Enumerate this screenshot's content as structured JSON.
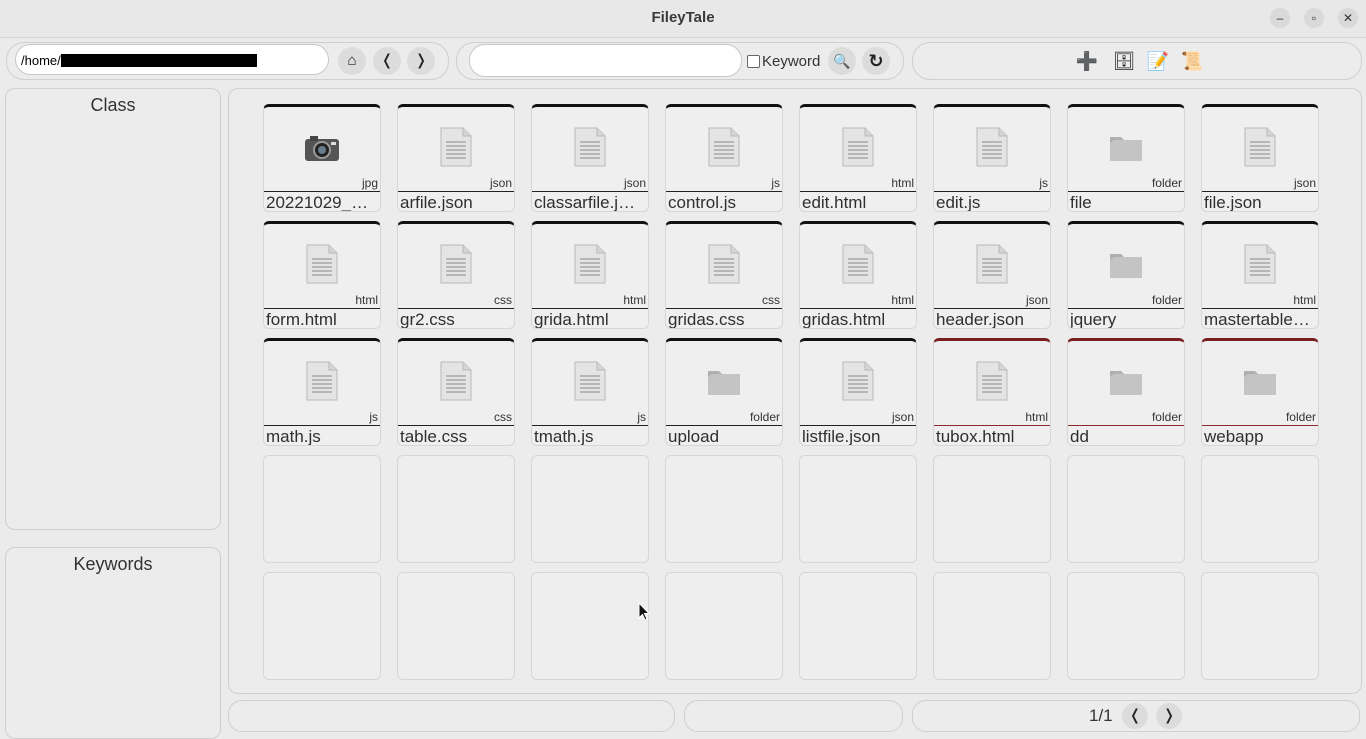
{
  "window": {
    "title": "FileyTale",
    "minimize": "–",
    "maximize": "▫",
    "close": "✕"
  },
  "toolbar": {
    "path_prefix": "/home/",
    "home_icon": "⌂",
    "back_icon": "❬",
    "forward_icon": "❭",
    "search_value": "",
    "keyword_label": "Keyword",
    "keyword_checked": false,
    "search_icon": "🔍",
    "refresh_icon": "↻",
    "add_icon": "➕",
    "cabinet_icon": "🗄",
    "note_icon": "📝",
    "scroll_icon": "📜"
  },
  "sidebar": {
    "class_title": "Class",
    "keywords_title": "Keywords"
  },
  "files": [
    {
      "name": "20221029_…",
      "ext": "jpg",
      "kind": "image",
      "red": false
    },
    {
      "name": "arfile.json",
      "ext": "json",
      "kind": "doc",
      "red": false
    },
    {
      "name": "classarfile.j…",
      "ext": "json",
      "kind": "doc",
      "red": false
    },
    {
      "name": "control.js",
      "ext": "js",
      "kind": "doc",
      "red": false
    },
    {
      "name": "edit.html",
      "ext": "html",
      "kind": "doc",
      "red": false
    },
    {
      "name": "edit.js",
      "ext": "js",
      "kind": "doc",
      "red": false
    },
    {
      "name": "file",
      "ext": "folder",
      "kind": "folder",
      "red": false
    },
    {
      "name": "file.json",
      "ext": "json",
      "kind": "doc",
      "red": false
    },
    {
      "name": "form.html",
      "ext": "html",
      "kind": "doc",
      "red": false
    },
    {
      "name": "gr2.css",
      "ext": "css",
      "kind": "doc",
      "red": false
    },
    {
      "name": "grida.html",
      "ext": "html",
      "kind": "doc",
      "red": false
    },
    {
      "name": "gridas.css",
      "ext": "css",
      "kind": "doc",
      "red": false
    },
    {
      "name": "gridas.html",
      "ext": "html",
      "kind": "doc",
      "red": false
    },
    {
      "name": "header.json",
      "ext": "json",
      "kind": "doc",
      "red": false
    },
    {
      "name": "jquery",
      "ext": "folder",
      "kind": "folder",
      "red": false
    },
    {
      "name": "mastertable…",
      "ext": "html",
      "kind": "doc",
      "red": false
    },
    {
      "name": "math.js",
      "ext": "js",
      "kind": "doc",
      "red": false
    },
    {
      "name": "table.css",
      "ext": "css",
      "kind": "doc",
      "red": false
    },
    {
      "name": "tmath.js",
      "ext": "js",
      "kind": "doc",
      "red": false
    },
    {
      "name": "upload",
      "ext": "folder",
      "kind": "folder",
      "red": false
    },
    {
      "name": "listfile.json",
      "ext": "json",
      "kind": "doc",
      "red": false
    },
    {
      "name": "tubox.html",
      "ext": "html",
      "kind": "doc",
      "red": true
    },
    {
      "name": "dd",
      "ext": "folder",
      "kind": "folder",
      "red": true
    },
    {
      "name": "webapp",
      "ext": "folder",
      "kind": "folder",
      "red": true
    }
  ],
  "pagination": {
    "page_info": "1/1",
    "prev_icon": "❬",
    "next_icon": "❭"
  }
}
